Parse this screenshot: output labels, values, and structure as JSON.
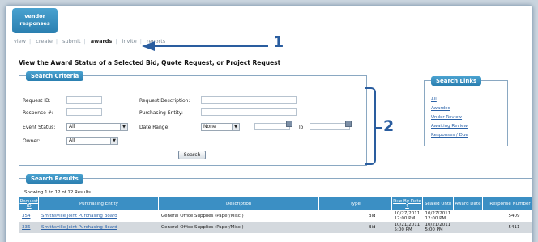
{
  "header": {
    "tab_label": "vendor responses"
  },
  "nav": {
    "items": [
      {
        "label": "view",
        "active": false
      },
      {
        "label": "create",
        "active": false
      },
      {
        "label": "submit",
        "active": false
      },
      {
        "label": "awards",
        "active": true
      },
      {
        "label": "invite",
        "active": false
      },
      {
        "label": "reports",
        "active": false
      }
    ],
    "separator": "|"
  },
  "callouts": {
    "one": "1",
    "two": "2"
  },
  "page_title": "View the Award Status of a Selected Bid, Quote Request, or Project Request",
  "search_criteria": {
    "heading": "Search Criteria",
    "request_id_label": "Request ID:",
    "request_id_value": "",
    "request_description_label": "Request Description:",
    "request_description_value": "",
    "response_no_label": "Response #:",
    "response_no_value": "",
    "purchasing_entity_label": "Purchasing Entity:",
    "purchasing_entity_value": "",
    "event_status_label": "Event Status:",
    "event_status_value": "All",
    "date_range_label": "Date Range:",
    "date_range_value": "None",
    "to_label": "To",
    "owner_label": "Owner:",
    "owner_value": "All",
    "search_button": "Search"
  },
  "search_links": {
    "heading": "Search Links",
    "links": [
      "All",
      "Awarded",
      "Under Review",
      "Awaiting Review",
      "Responses / Due"
    ]
  },
  "search_results": {
    "heading": "Search Results",
    "showing": "Showing 1 to 12 of 12 Results",
    "columns": [
      "Request ID",
      "Purchasing Entity",
      "Description",
      "Type",
      "Due By Date ↑",
      "Sealed Until",
      "Award Date",
      "Response Number"
    ],
    "rows": [
      {
        "id": "354",
        "entity": "Smithsville Joint Purchasing Board",
        "description": "General Office Supplies (Paper/Misc.)",
        "type": "Bid",
        "due": "10/27/2011 12:00 PM",
        "sealed": "10/27/2011 12:00 PM",
        "award": "",
        "response": "5409"
      },
      {
        "id": "336",
        "entity": "Smithsville Joint Purchasing Board",
        "description": "General Office Supplies (Paper/Misc.)",
        "type": "Bid",
        "due": "10/21/2011 5:00 PM",
        "sealed": "10/21/2011 5:00 PM",
        "award": "",
        "response": "5411"
      }
    ]
  }
}
